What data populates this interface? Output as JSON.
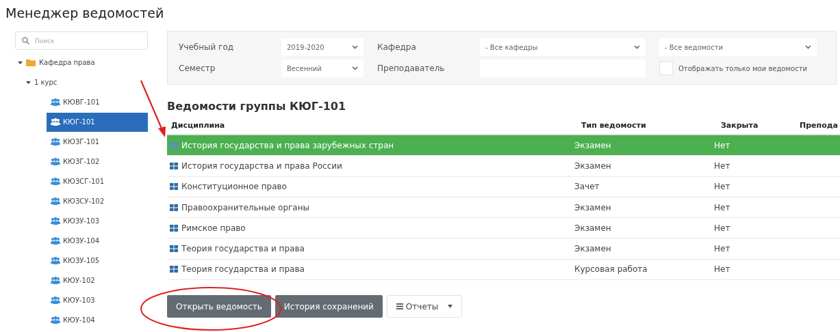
{
  "title": "Менеджер ведомостей",
  "search": {
    "placeholder": "Поиск"
  },
  "tree": [
    {
      "label": "Кафедра права",
      "kind": "folder",
      "expanded": true,
      "children": [
        {
          "label": "1 курс",
          "kind": "course",
          "expanded": true,
          "children": [
            {
              "label": "КЮВГ-101",
              "kind": "group",
              "selected": false
            },
            {
              "label": "КЮГ-101",
              "kind": "group",
              "selected": true
            },
            {
              "label": "КЮЗГ-101",
              "kind": "group",
              "selected": false
            },
            {
              "label": "КЮЗГ-102",
              "kind": "group",
              "selected": false
            },
            {
              "label": "КЮЗСГ-101",
              "kind": "group",
              "selected": false
            },
            {
              "label": "КЮЗСУ-102",
              "kind": "group",
              "selected": false
            },
            {
              "label": "КЮЗУ-103",
              "kind": "group",
              "selected": false
            },
            {
              "label": "КЮЗУ-104",
              "kind": "group",
              "selected": false
            },
            {
              "label": "КЮЗУ-105",
              "kind": "group",
              "selected": false
            },
            {
              "label": "КЮУ-102",
              "kind": "group",
              "selected": false
            },
            {
              "label": "КЮУ-103",
              "kind": "group",
              "selected": false
            },
            {
              "label": "КЮУ-104",
              "kind": "group",
              "selected": false
            }
          ]
        }
      ]
    }
  ],
  "filters": {
    "year_label": "Учебный год",
    "year_value": "2019-2020",
    "department_label": "Кафедра",
    "department_value": "- Все кафедры",
    "sheets_value": "- Все ведомости",
    "semester_label": "Семестр",
    "semester_value": "Весенний",
    "teacher_label": "Преподаватель",
    "only_mine": {
      "label": "Отображать только мои ведомости",
      "checked": false
    }
  },
  "table": {
    "title": "Ведомости группы КЮГ-101",
    "columns": [
      "Дисциплина",
      "Тип ведомости",
      "Закрыта",
      "Препода"
    ],
    "rows": [
      {
        "cells": [
          "История государства и права зарубежных стран",
          "Экзамен",
          "Нет"
        ],
        "selected": true
      },
      {
        "cells": [
          "История государства и права России",
          "Экзамен",
          "Нет"
        ],
        "selected": false
      },
      {
        "cells": [
          "Конституционное право",
          "Зачет",
          "Нет"
        ],
        "selected": false
      },
      {
        "cells": [
          "Правоохранительные органы",
          "Экзамен",
          "Нет"
        ],
        "selected": false
      },
      {
        "cells": [
          "Римское право",
          "Экзамен",
          "Нет"
        ],
        "selected": false
      },
      {
        "cells": [
          "Теория государства и права",
          "Экзамен",
          "Нет"
        ],
        "selected": false
      },
      {
        "cells": [
          "Теория государства и права",
          "Курсовая работа",
          "Нет"
        ],
        "selected": false
      }
    ]
  },
  "buttons": [
    {
      "label": "Открыть ведомость",
      "kind": "primary"
    },
    {
      "label": "История сохранений",
      "kind": "primary"
    },
    {
      "label": "Отчеты",
      "kind": "menu"
    }
  ]
}
